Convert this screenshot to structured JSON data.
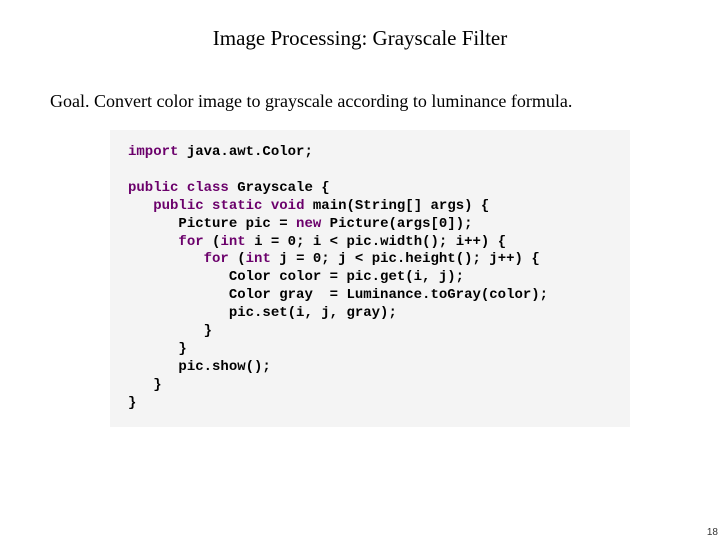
{
  "title": "Image Processing:  Grayscale Filter",
  "goal_label": "Goal.",
  "goal_text": "  Convert color image to grayscale according to luminance formula.",
  "code": {
    "l1_kw1": "import",
    "l1_rest": " java.awt.Color;",
    "l3_kw1": "public",
    "l3_kw2": "class",
    "l3_name": "Grayscale",
    "l3_br": " {",
    "l4_ind": "   ",
    "l4_kw1": "public",
    "l4_kw2": "static",
    "l4_kw3": "void",
    "l4_name": "main",
    "l4_sig": "(String[] args)",
    "l4_br": " {",
    "l5_ind": "      ",
    "l5_txt1": "Picture pic = ",
    "l5_kw": "new",
    "l5_txt2": " Picture(args[0]);",
    "l6_ind": "      ",
    "l6_kw": "for",
    "l6_txt": " (",
    "l6_kw2": "int",
    "l6_txt2": " i = 0; i < pic.width(); i++) {",
    "l7_ind": "         ",
    "l7_kw": "for",
    "l7_txt": " (",
    "l7_kw2": "int",
    "l7_txt2": " j = 0; j < pic.height(); j++) {",
    "l8_ind": "            ",
    "l8_txt": "Color color = pic.get(i, j);",
    "l9_ind": "            ",
    "l9_txt": "Color gray  = Luminance.toGray(color);",
    "l10_ind": "            ",
    "l10_txt": "pic.set(i, j, gray);",
    "l11_ind": "         ",
    "l11_txt": "}",
    "l12_ind": "      ",
    "l12_txt": "}",
    "l13_ind": "      ",
    "l13_txt": "pic.show();",
    "l14_ind": "   ",
    "l14_txt": "}",
    "l15_txt": "}"
  },
  "page_number": "18"
}
